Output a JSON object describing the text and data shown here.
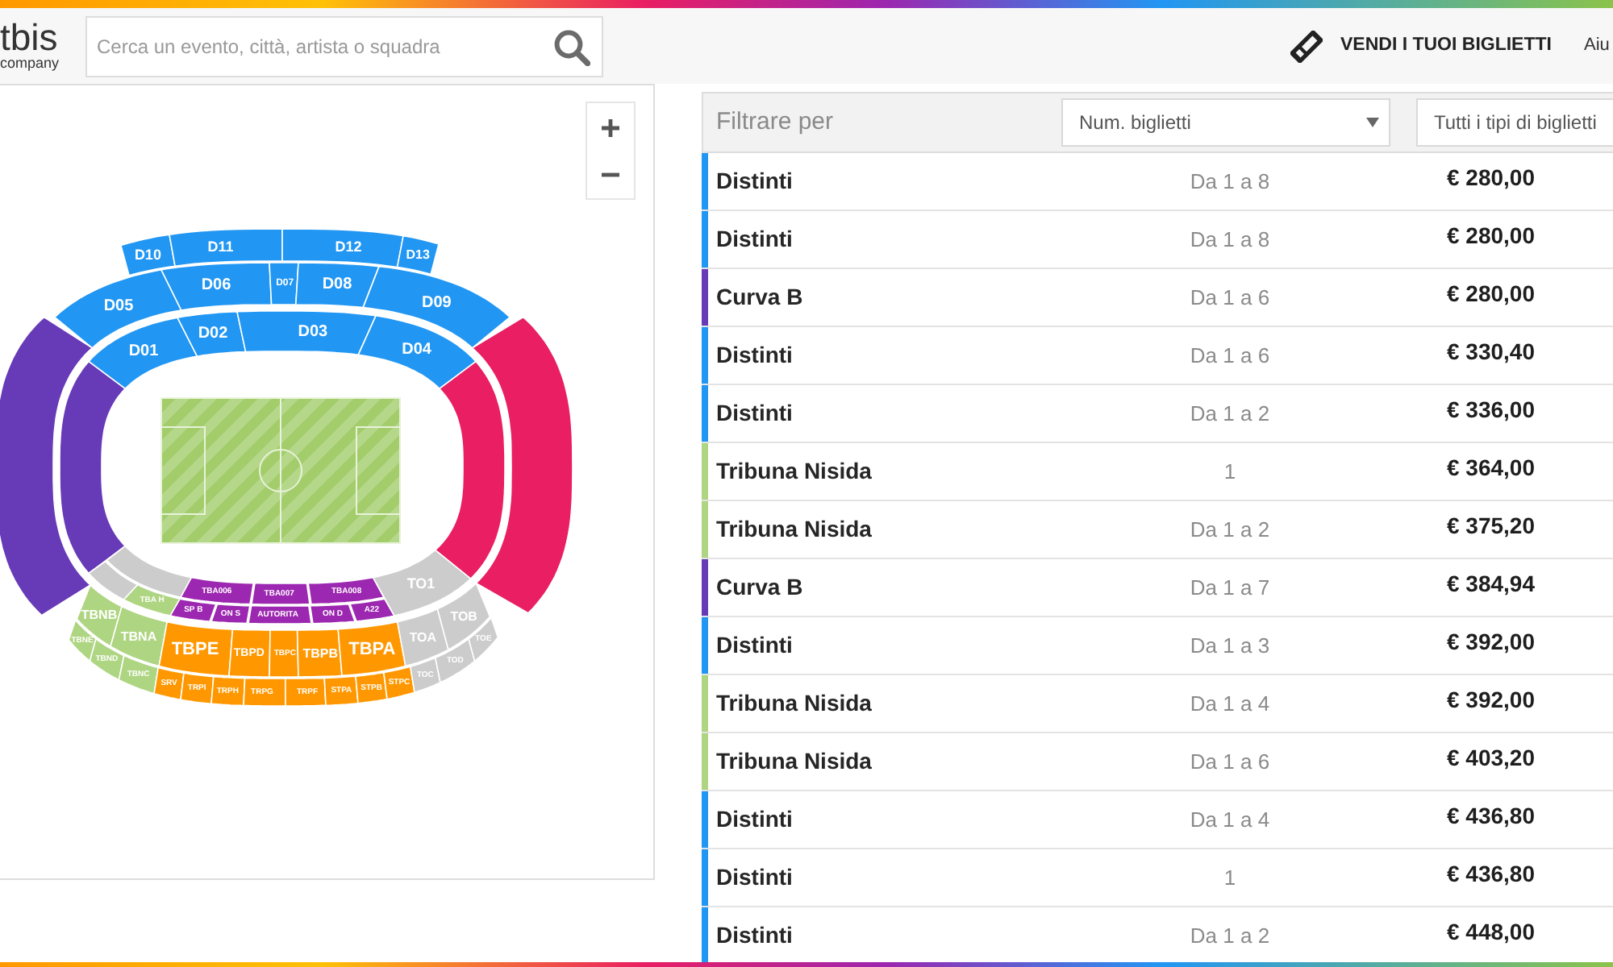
{
  "header": {
    "logo": {
      "text": "tbis",
      "tagline": "company"
    },
    "search": {
      "placeholder": "Cerca un evento, città, artista o squadra"
    },
    "sell_link": "VENDI I TUOI BIGLIETTI",
    "help_link": "Aiu"
  },
  "stadium_map": {
    "sections": [
      {
        "label": "D10",
        "color": "#2196f3"
      },
      {
        "label": "D11",
        "color": "#2196f3"
      },
      {
        "label": "D12",
        "color": "#2196f3"
      },
      {
        "label": "D13",
        "color": "#2196f3"
      },
      {
        "label": "D05",
        "color": "#2196f3"
      },
      {
        "label": "D06",
        "color": "#2196f3"
      },
      {
        "label": "D07",
        "color": "#2196f3"
      },
      {
        "label": "D08",
        "color": "#2196f3"
      },
      {
        "label": "D09",
        "color": "#2196f3"
      },
      {
        "label": "D01",
        "color": "#2196f3"
      },
      {
        "label": "D02",
        "color": "#2196f3"
      },
      {
        "label": "D03",
        "color": "#2196f3"
      },
      {
        "label": "D04",
        "color": "#2196f3"
      },
      {
        "color": "#673ab7"
      },
      {
        "color": "#673ab7"
      },
      {
        "color": "#e91e63"
      },
      {
        "color": "#e91e63"
      },
      {
        "color": "#cccccc"
      },
      {
        "color": "#cccccc"
      },
      {
        "label": "TBA H",
        "color": "#aed581"
      },
      {
        "label": "TBA006",
        "color": "#9c27b0"
      },
      {
        "label": "TBA007",
        "color": "#9c27b0"
      },
      {
        "label": "TBA008",
        "color": "#9c27b0"
      },
      {
        "label": "SP B",
        "color": "#9c27b0"
      },
      {
        "label": "ON S",
        "color": "#9c27b0"
      },
      {
        "label": "AUTORITA",
        "color": "#9c27b0"
      },
      {
        "label": "ON D",
        "color": "#9c27b0"
      },
      {
        "label": "A22",
        "color": "#9c27b0"
      },
      {
        "label": "TO1",
        "color": "#cccccc"
      },
      {
        "label": "TBNB",
        "color": "#aed581"
      },
      {
        "label": "TBNA",
        "color": "#aed581"
      },
      {
        "label": "TBPE",
        "color": "#ff9800"
      },
      {
        "label": "TBPD",
        "color": "#ff9800"
      },
      {
        "label": "TBPC",
        "color": "#ff9800"
      },
      {
        "label": "TBPB",
        "color": "#ff9800"
      },
      {
        "label": "TBPA",
        "color": "#ff9800"
      },
      {
        "label": "TOA",
        "color": "#cccccc"
      },
      {
        "label": "TOB",
        "color": "#cccccc"
      },
      {
        "label": "TBNE",
        "color": "#aed581"
      },
      {
        "label": "TBND",
        "color": "#aed581"
      },
      {
        "label": "TBNC",
        "color": "#aed581"
      },
      {
        "label": "SRV",
        "color": "#ff9800"
      },
      {
        "label": "TRPI",
        "color": "#ff9800"
      },
      {
        "label": "TRPH",
        "color": "#ff9800"
      },
      {
        "label": "TRPG",
        "color": "#ff9800"
      },
      {
        "label": "TRPF",
        "color": "#ff9800"
      },
      {
        "label": "STPA",
        "color": "#ff9800"
      },
      {
        "label": "STPB",
        "color": "#ff9800"
      },
      {
        "label": "STPC",
        "color": "#ff9800"
      },
      {
        "label": "TOC",
        "color": "#cccccc"
      },
      {
        "label": "TOD",
        "color": "#cccccc"
      },
      {
        "label": "TOE",
        "color": "#cccccc"
      }
    ]
  },
  "filter_bar": {
    "label": "Filtrare per",
    "quantity_select": {
      "value": "Num. biglietti"
    },
    "type_select": {
      "value": "Tutti i tipi di biglietti"
    }
  },
  "listings": [
    {
      "section": "Distinti",
      "color": "#2196f3",
      "quantity": "Da 1 a 8",
      "price": "€ 280,00"
    },
    {
      "section": "Distinti",
      "color": "#2196f3",
      "quantity": "Da 1 a 8",
      "price": "€ 280,00"
    },
    {
      "section": "Curva B",
      "color": "#673ab7",
      "quantity": "Da 1 a 6",
      "price": "€ 280,00"
    },
    {
      "section": "Distinti",
      "color": "#2196f3",
      "quantity": "Da 1 a 6",
      "price": "€ 330,40"
    },
    {
      "section": "Distinti",
      "color": "#2196f3",
      "quantity": "Da 1 a 2",
      "price": "€ 336,00"
    },
    {
      "section": "Tribuna Nisida",
      "color": "#aed581",
      "quantity": "1",
      "price": "€ 364,00"
    },
    {
      "section": "Tribuna Nisida",
      "color": "#aed581",
      "quantity": "Da 1 a 2",
      "price": "€ 375,20"
    },
    {
      "section": "Curva B",
      "color": "#673ab7",
      "quantity": "Da 1 a 7",
      "price": "€ 384,94"
    },
    {
      "section": "Distinti",
      "color": "#2196f3",
      "quantity": "Da 1 a 3",
      "price": "€ 392,00"
    },
    {
      "section": "Tribuna Nisida",
      "color": "#aed581",
      "quantity": "Da 1 a 4",
      "price": "€ 392,00"
    },
    {
      "section": "Tribuna Nisida",
      "color": "#aed581",
      "quantity": "Da 1 a 6",
      "price": "€ 403,20"
    },
    {
      "section": "Distinti",
      "color": "#2196f3",
      "quantity": "Da 1 a 4",
      "price": "€ 436,80"
    },
    {
      "section": "Distinti",
      "color": "#2196f3",
      "quantity": "1",
      "price": "€ 436,80"
    },
    {
      "section": "Distinti",
      "color": "#2196f3",
      "quantity": "Da 1 a 2",
      "price": "€ 448,00"
    }
  ]
}
